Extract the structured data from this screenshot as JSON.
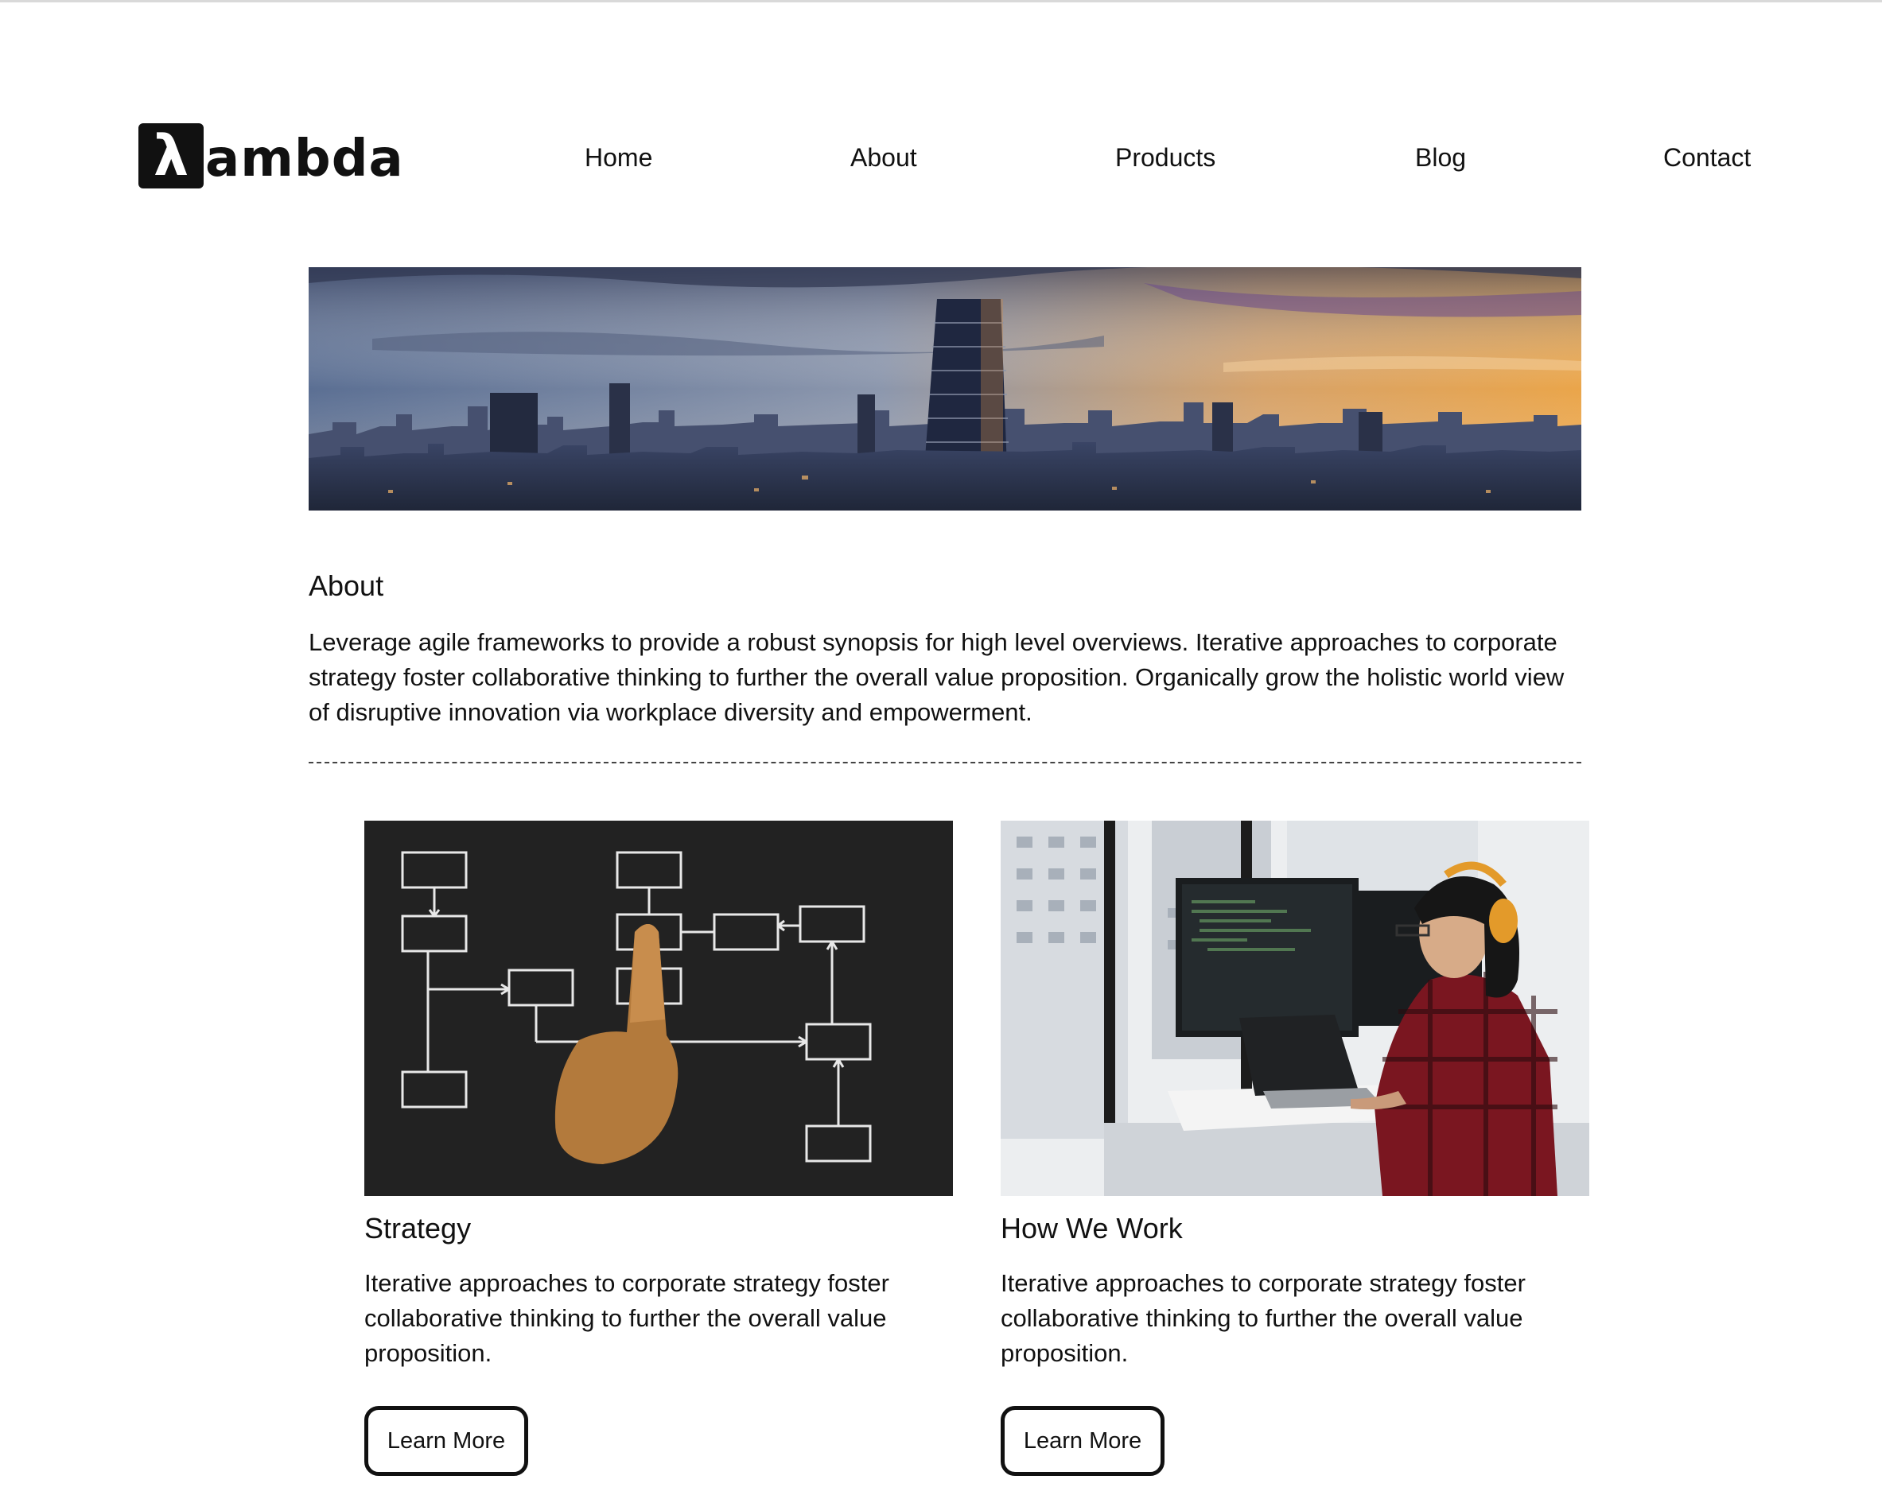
{
  "header": {
    "logo_mark": "λ",
    "logo_text": "ambda",
    "nav": [
      "Home",
      "About",
      "Products",
      "Blog",
      "Contact"
    ]
  },
  "hero": {
    "image": "city-skyline-at-sunset"
  },
  "about": {
    "heading": "About",
    "body": "Leverage agile frameworks to provide a robust synopsis for high level overviews. Iterative approaches to corporate strategy foster collaborative thinking to further the overall value proposition. Organically grow the holistic world view of disruptive innovation via workplace diversity and empowerment."
  },
  "cards": [
    {
      "image": "hand-pointing-at-chalk-flowchart",
      "title": "Strategy",
      "text": "Iterative approaches to corporate strategy foster collaborative thinking to further the overall value proposition.",
      "button": "Learn More"
    },
    {
      "image": "woman-with-headphones-at-computer-desk",
      "title": "How We Work",
      "text": "Iterative approaches to corporate strategy foster collaborative thinking to further the overall value proposition.",
      "button": "Learn More"
    }
  ],
  "colors": {
    "text": "#111111",
    "background": "#ffffff",
    "divider": "#444444"
  }
}
